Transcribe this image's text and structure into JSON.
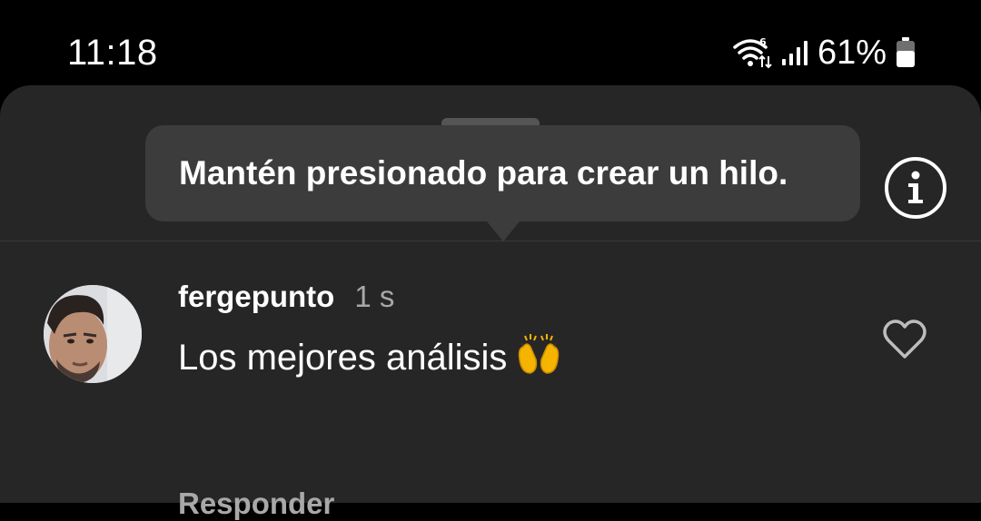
{
  "status_bar": {
    "time": "11:18",
    "wifi_icon": "wifi-6-icon",
    "signal_icon": "signal-bars-icon",
    "battery_percent": "61%",
    "battery_icon": "battery-icon",
    "battery_level": 0.61
  },
  "tooltip": {
    "text": "Mantén presionado para crear un hilo."
  },
  "info_icon": "info-icon",
  "comment": {
    "username": "fergepunto",
    "time_ago": "1 s",
    "text": "Los mejores análisis",
    "emoji_icon": "raising-hands-emoji-icon",
    "reply_label": "Responder",
    "like_icon": "heart-outline-icon"
  },
  "colors": {
    "background": "#000000",
    "sheet": "#262626",
    "tooltip": "#3c3c3c",
    "secondary_text": "#a8a8a8"
  }
}
